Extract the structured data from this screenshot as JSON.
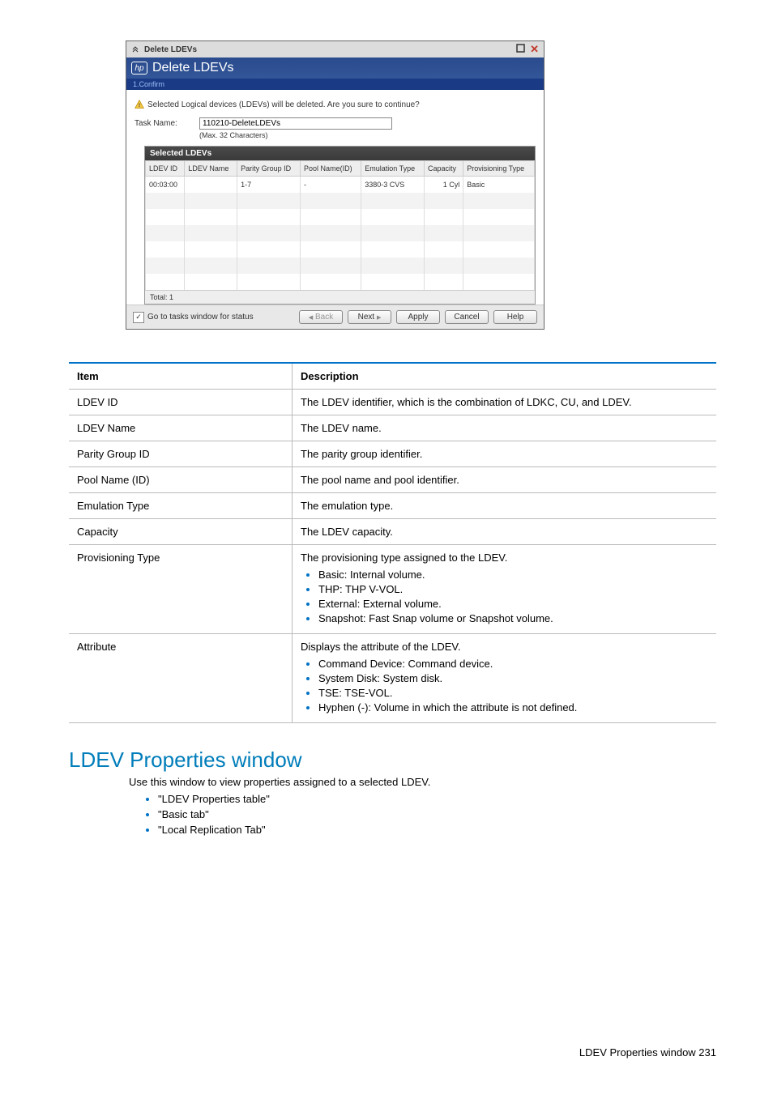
{
  "dialog": {
    "window_title": "Delete LDEVs",
    "header_title": "Delete LDEVs",
    "step_label": "1.Confirm",
    "warning_text": "Selected Logical devices (LDEVs) will be deleted. Are you sure to continue?",
    "task_name_label": "Task Name:",
    "task_name_value": "110210-DeleteLDEVs",
    "task_name_hint": "(Max. 32 Characters)",
    "selected_title": "Selected LDEVs",
    "columns": [
      "LDEV ID",
      "LDEV Name",
      "Parity Group ID",
      "Pool Name(ID)",
      "Emulation Type",
      "Capacity",
      "Provisioning Type"
    ],
    "row": [
      "00:03:00",
      "",
      "1-7",
      "-",
      "3380-3 CVS",
      "1 Cyl",
      "Basic"
    ],
    "total_label": "Total:  1",
    "check_label": "Go to tasks window for status",
    "buttons": {
      "back": "Back",
      "next": "Next",
      "apply": "Apply",
      "cancel": "Cancel",
      "help": "Help"
    }
  },
  "desc": {
    "head_item": "Item",
    "head_desc": "Description",
    "rows": [
      {
        "item": "LDEV ID",
        "desc": "The LDEV identifier, which is the combination of LDKC, CU, and LDEV."
      },
      {
        "item": "LDEV Name",
        "desc": "The LDEV name."
      },
      {
        "item": "Parity Group ID",
        "desc": "The parity group identifier."
      },
      {
        "item": "Pool Name (ID)",
        "desc": "The pool name and pool identifier."
      },
      {
        "item": "Emulation Type",
        "desc": "The emulation type."
      },
      {
        "item": "Capacity",
        "desc": "The LDEV capacity."
      }
    ],
    "prov": {
      "item": "Provisioning Type",
      "desc": "The provisioning type assigned to the LDEV.",
      "bullets": [
        "Basic: Internal volume.",
        "THP: THP V-VOL.",
        "External: External volume.",
        "Snapshot: Fast Snap volume or Snapshot volume."
      ]
    },
    "attr": {
      "item": "Attribute",
      "desc": "Displays the attribute of the LDEV.",
      "bullets": [
        "Command Device: Command device.",
        "System Disk: System disk.",
        "TSE: TSE-VOL.",
        "Hyphen (-): Volume in which the attribute is not defined."
      ]
    }
  },
  "section": {
    "title": "LDEV Properties window",
    "intro": "Use this window to view properties assigned to a selected LDEV.",
    "links": [
      "\"LDEV Properties table\"",
      "\"Basic tab\"",
      "\"Local Replication Tab\""
    ]
  },
  "footer": "LDEV Properties window   231"
}
